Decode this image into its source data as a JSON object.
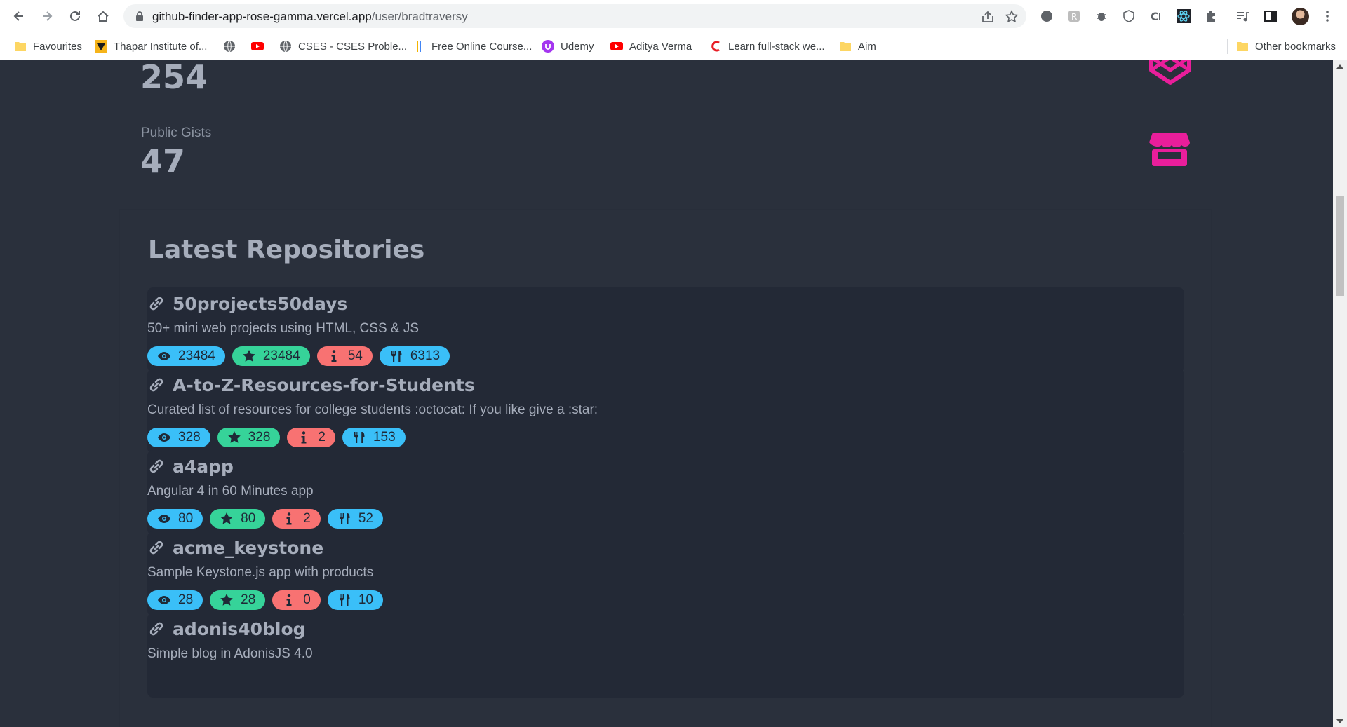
{
  "browser": {
    "url_host": "github-finder-app-rose-gamma.vercel.app",
    "url_path": "/user/bradtraversy"
  },
  "bookmarks": [
    {
      "label": "Favourites",
      "icon": "folder-icon"
    },
    {
      "label": "Thapar Institute of...",
      "icon": "thapar-icon"
    },
    {
      "label": "",
      "icon": "globe-icon"
    },
    {
      "label": "",
      "icon": "youtube-icon"
    },
    {
      "label": "CSES - CSES Proble...",
      "icon": "globe-icon"
    },
    {
      "label": "Free Online Course...",
      "icon": "course-icon"
    },
    {
      "label": "Udemy",
      "icon": "udemy-icon"
    },
    {
      "label": "Aditya Verma",
      "icon": "youtube-icon"
    },
    {
      "label": "Learn full-stack we...",
      "icon": "codecademy-icon"
    },
    {
      "label": "Aim",
      "icon": "folder-icon"
    }
  ],
  "other_bookmarks": "Other bookmarks",
  "stats": {
    "first_value": "254",
    "gists_label": "Public Gists",
    "gists_value": "47"
  },
  "repos_title": "Latest Repositories",
  "repos": [
    {
      "name": "50projects50days",
      "description": "50+ mini web projects using HTML, CSS & JS",
      "watchers": "23484",
      "stars": "23484",
      "issues": "54",
      "forks": "6313"
    },
    {
      "name": "A-to-Z-Resources-for-Students",
      "description": "Curated list of resources for college students :octocat: If you like give a :star:",
      "watchers": "328",
      "stars": "328",
      "issues": "2",
      "forks": "153"
    },
    {
      "name": "a4app",
      "description": "Angular 4 in 60 Minutes app",
      "watchers": "80",
      "stars": "80",
      "issues": "2",
      "forks": "52"
    },
    {
      "name": "acme_keystone",
      "description": "Sample Keystone.js app with products",
      "watchers": "28",
      "stars": "28",
      "issues": "0",
      "forks": "10"
    },
    {
      "name": "adonis40blog",
      "description": "Simple blog in AdonisJS 4.0",
      "watchers": "",
      "stars": "",
      "issues": "",
      "forks": ""
    }
  ],
  "colors": {
    "page_bg": "#2a303c",
    "card_bg": "#232936",
    "text": "#a6adbb",
    "accent_pink": "#e91e9b",
    "badge_info": "#3abff8",
    "badge_success": "#36d399",
    "badge_error": "#f87272"
  }
}
